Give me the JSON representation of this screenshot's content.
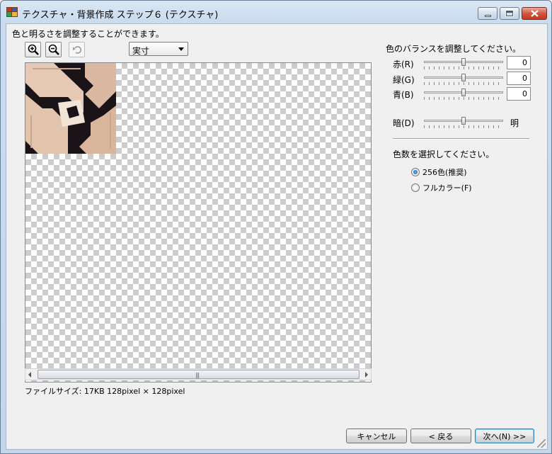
{
  "window": {
    "title": "テクスチャ・背景作成 ステップ６ (テクスチャ)"
  },
  "instruction": "色と明るさを調整することができます。",
  "toolbar": {
    "zoom_select": "実寸"
  },
  "preview": {
    "file_info": "ファイルサイズ: 17KB 128pixel × 128pixel"
  },
  "balance": {
    "title": "色のバランスを調整してください。",
    "red_label": "赤(R)",
    "red_value": "0",
    "green_label": "緑(G)",
    "green_value": "0",
    "blue_label": "青(B)",
    "blue_value": "0",
    "dark_label": "暗(D)",
    "bright_label": "明",
    "red_level": 0.5,
    "green_level": 0.5,
    "blue_level": 0.5,
    "brightness_level": 0.5
  },
  "colors": {
    "title": "色数を選択してください。",
    "option_256": "256色(推奨)",
    "option_full": "フルカラー(F)",
    "selected": "256色(推奨)"
  },
  "buttons": {
    "cancel": "キャンセル",
    "back": "< 戻る",
    "next": "次へ(N) >>"
  }
}
